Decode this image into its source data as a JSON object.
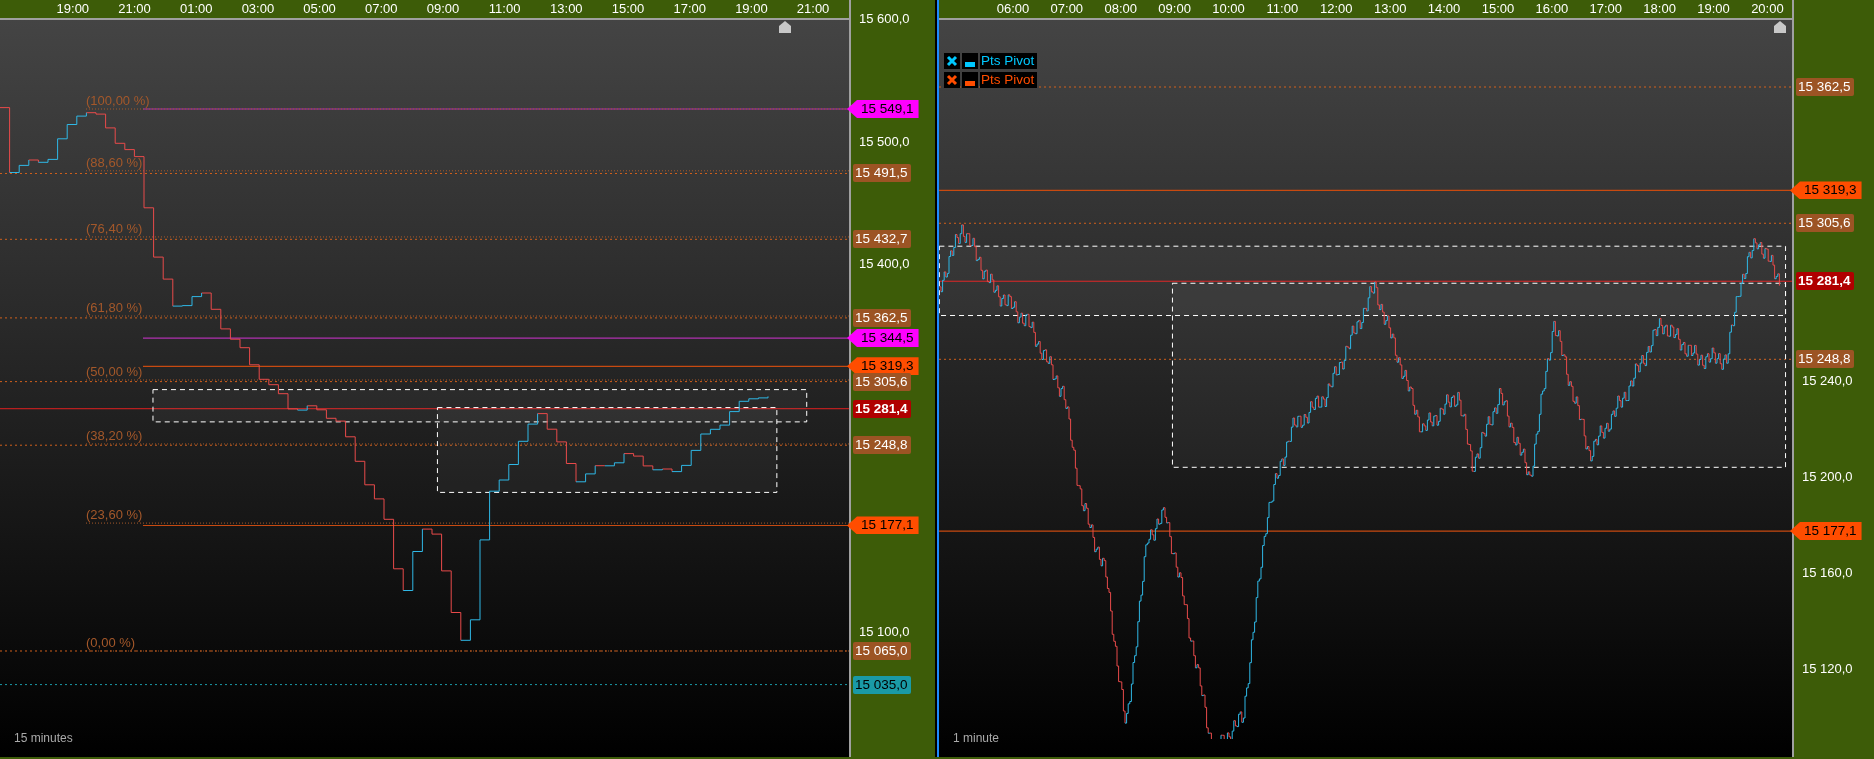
{
  "panels": [
    {
      "time_axis": [
        "19:00",
        "21:00",
        "01:00",
        "03:00",
        "05:00",
        "07:00",
        "09:00",
        "11:00",
        "13:00",
        "15:00",
        "17:00",
        "19:00",
        "21:00"
      ],
      "timeframe": "15 minutes",
      "fib_levels": [
        {
          "label": "(100,00 %)"
        },
        {
          "label": "(88,60 %)"
        },
        {
          "label": "(76,40 %)"
        },
        {
          "label": "(61,80 %)"
        },
        {
          "label": "(50,00 %)"
        },
        {
          "label": "(38,20 %)"
        },
        {
          "label": "(23,60 %)"
        },
        {
          "label": "(0,00 %)"
        }
      ],
      "price_ticks": [
        "15 600,0",
        "15 500,0",
        "15 400,0",
        "15 100,0"
      ],
      "price_tags": [
        {
          "text": "15 549,1",
          "kind": "pointer",
          "color": "#ff00ff"
        },
        {
          "text": "15 491,5",
          "kind": "box",
          "color": "#9c5424"
        },
        {
          "text": "15 432,7",
          "kind": "box",
          "color": "#9c5424"
        },
        {
          "text": "15 362,5",
          "kind": "box",
          "color": "#9c5424"
        },
        {
          "text": "15 344,5",
          "kind": "pointer",
          "color": "#ff00ff"
        },
        {
          "text": "15 319,3",
          "kind": "pointer",
          "color": "#ff4d00"
        },
        {
          "text": "15 305,6",
          "kind": "box",
          "color": "#9c5424"
        },
        {
          "text": "15 281,4",
          "kind": "last",
          "color": "#b00000"
        },
        {
          "text": "15 248,8",
          "kind": "box",
          "color": "#9c5424"
        },
        {
          "text": "15 177,1",
          "kind": "pointer",
          "color": "#ff4d00"
        },
        {
          "text": "15 065,0",
          "kind": "box",
          "color": "#9c5424"
        },
        {
          "text": "15 035,0",
          "kind": "box",
          "color": "#1a9aa6"
        }
      ]
    },
    {
      "time_axis": [
        "06:00",
        "07:00",
        "08:00",
        "09:00",
        "10:00",
        "11:00",
        "12:00",
        "13:00",
        "14:00",
        "15:00",
        "16:00",
        "17:00",
        "18:00",
        "19:00",
        "20:00"
      ],
      "timeframe": "1 minute",
      "legend": [
        {
          "label": "Pts Pivot",
          "color": "#00c8ff"
        },
        {
          "label": "Pts Pivot",
          "color": "#ff4d00"
        }
      ],
      "price_ticks": [
        "15 240,0",
        "15 200,0",
        "15 160,0",
        "15 120,0"
      ],
      "price_tags": [
        {
          "text": "15 362,5",
          "kind": "box",
          "color": "#9c5424"
        },
        {
          "text": "15 319,3",
          "kind": "pointer",
          "color": "#ff4d00"
        },
        {
          "text": "15 305,6",
          "kind": "box",
          "color": "#9c5424"
        },
        {
          "text": "15 281,4",
          "kind": "last",
          "color": "#b00000"
        },
        {
          "text": "15 248,8",
          "kind": "box",
          "color": "#9c5424"
        },
        {
          "text": "15 177,1",
          "kind": "pointer",
          "color": "#ff4d00"
        }
      ]
    }
  ]
}
